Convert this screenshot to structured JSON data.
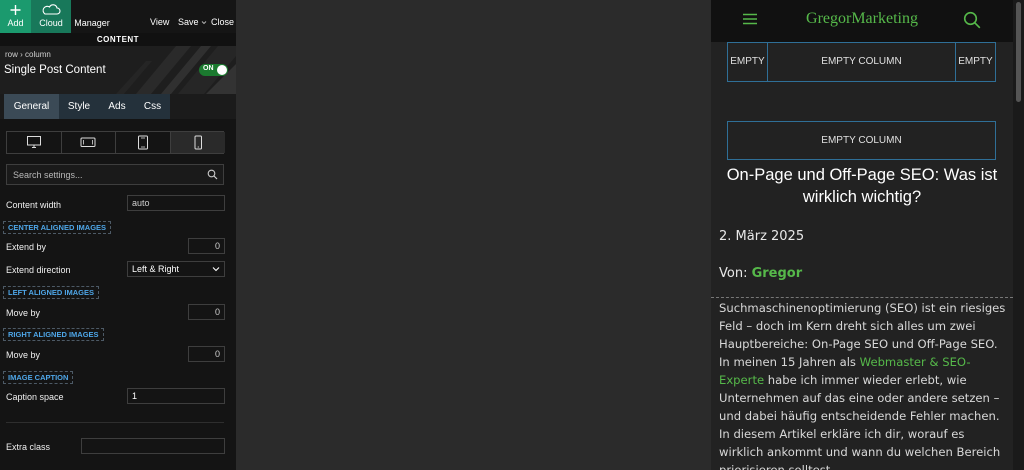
{
  "toolbar": {
    "add_label": "Add",
    "cloud_label": "Cloud",
    "manager_label": "Manager",
    "view_label": "View",
    "save_label": "Save",
    "close_label": "Close"
  },
  "panel": {
    "section_label": "CONTENT",
    "breadcrumb": [
      "row",
      "column"
    ],
    "element_title": "Single Post Content",
    "toggle_label": "ON",
    "tabs": [
      "General",
      "Style",
      "Ads",
      "Css"
    ],
    "search_placeholder": "Search settings...",
    "fields": {
      "content_width_label": "Content width",
      "content_width_value": "auto",
      "center_section": "CENTER ALIGNED IMAGES",
      "extend_by_label": "Extend by",
      "extend_by_value": "0",
      "extend_direction_label": "Extend direction",
      "extend_direction_value": "Left & Right",
      "left_section": "LEFT ALIGNED IMAGES",
      "left_move_label": "Move by",
      "left_move_value": "0",
      "right_section": "RIGHT ALIGNED IMAGES",
      "right_move_label": "Move by",
      "right_move_value": "0",
      "caption_section": "IMAGE CAPTION",
      "caption_space_label": "Caption space",
      "caption_space_value": "1",
      "extra_class_label": "Extra class",
      "extra_class_value": ""
    }
  },
  "preview": {
    "brand": "GregorMarketing",
    "empty_short": "EMPTY",
    "empty_long": "EMPTY COLUMN",
    "title": "On-Page und Off-Page SEO: Was ist wirklich wichtig?",
    "date": "2. März 2025",
    "by_prefix": "Von: ",
    "author": "Gregor",
    "body_before": "Suchmaschinenoptimierung (SEO) ist ein riesiges Feld – doch im Kern dreht sich alles um zwei Hauptbereiche: On-Page SEO und Off-Page SEO. In meinen 15 Jahren als ",
    "body_link": "Webmaster & SEO-Experte",
    "body_after": " habe ich immer wieder erlebt, wie Unternehmen auf das eine oder andere setzen – und dabei häufig entscheidende Fehler machen. In diesem Artikel erkläre ich dir, worauf es wirklich ankommt und wann du welchen Bereich priorisieren solltest."
  },
  "colors": {
    "accent_green": "#56b94a",
    "add_button": "#1b9a6e",
    "section_blue": "#4ea6e8"
  }
}
